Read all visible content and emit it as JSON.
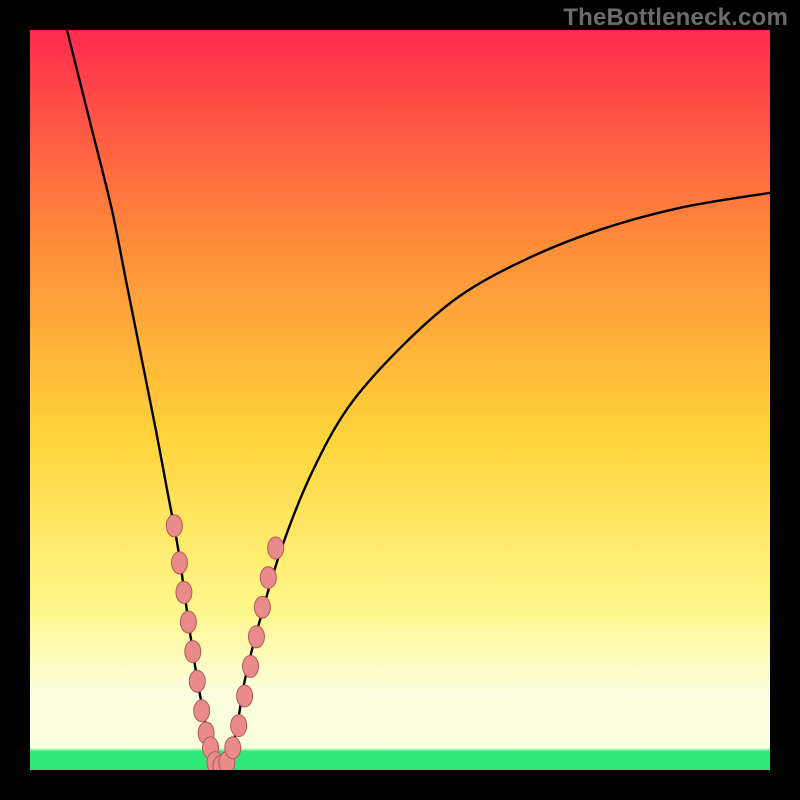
{
  "watermark": "TheBottleneck.com",
  "colors": {
    "frame": "#000000",
    "grad_top": "#ff2a4d",
    "grad_upper_mid": "#ff8a3a",
    "grad_mid": "#ffd43a",
    "grad_lower_mid": "#fff78a",
    "grad_pale": "#fbffe0",
    "grad_green": "#2fe87a",
    "curve": "#000000",
    "marker_fill": "#e98b8a",
    "marker_stroke": "#b05a58"
  },
  "chart_data": {
    "type": "line",
    "title": "",
    "xlabel": "",
    "ylabel": "",
    "xlim": [
      0,
      100
    ],
    "ylim": [
      0,
      100
    ],
    "grid": false,
    "legend": false,
    "series": [
      {
        "name": "bottleneck-curve",
        "x": [
          5,
          8,
          11,
          13,
          15,
          17,
          18.5,
          20,
          21,
          22,
          23,
          24,
          25,
          26,
          27,
          28,
          29,
          31,
          34,
          38,
          43,
          50,
          58,
          67,
          77,
          88,
          100
        ],
        "y": [
          100,
          88,
          76,
          66,
          56,
          46,
          38,
          30,
          23,
          16,
          10,
          5,
          2,
          0,
          2,
          6,
          12,
          20,
          30,
          40,
          49,
          57,
          64,
          69,
          73,
          76,
          78
        ]
      }
    ],
    "markers": [
      {
        "x": 19.5,
        "y": 33
      },
      {
        "x": 20.2,
        "y": 28
      },
      {
        "x": 20.8,
        "y": 24
      },
      {
        "x": 21.4,
        "y": 20
      },
      {
        "x": 22.0,
        "y": 16
      },
      {
        "x": 22.6,
        "y": 12
      },
      {
        "x": 23.2,
        "y": 8
      },
      {
        "x": 23.8,
        "y": 5
      },
      {
        "x": 24.4,
        "y": 3
      },
      {
        "x": 25.0,
        "y": 1
      },
      {
        "x": 25.8,
        "y": 0.5
      },
      {
        "x": 26.6,
        "y": 1
      },
      {
        "x": 27.4,
        "y": 3
      },
      {
        "x": 28.2,
        "y": 6
      },
      {
        "x": 29.0,
        "y": 10
      },
      {
        "x": 29.8,
        "y": 14
      },
      {
        "x": 30.6,
        "y": 18
      },
      {
        "x": 31.4,
        "y": 22
      },
      {
        "x": 32.2,
        "y": 26
      },
      {
        "x": 33.2,
        "y": 30
      }
    ]
  }
}
